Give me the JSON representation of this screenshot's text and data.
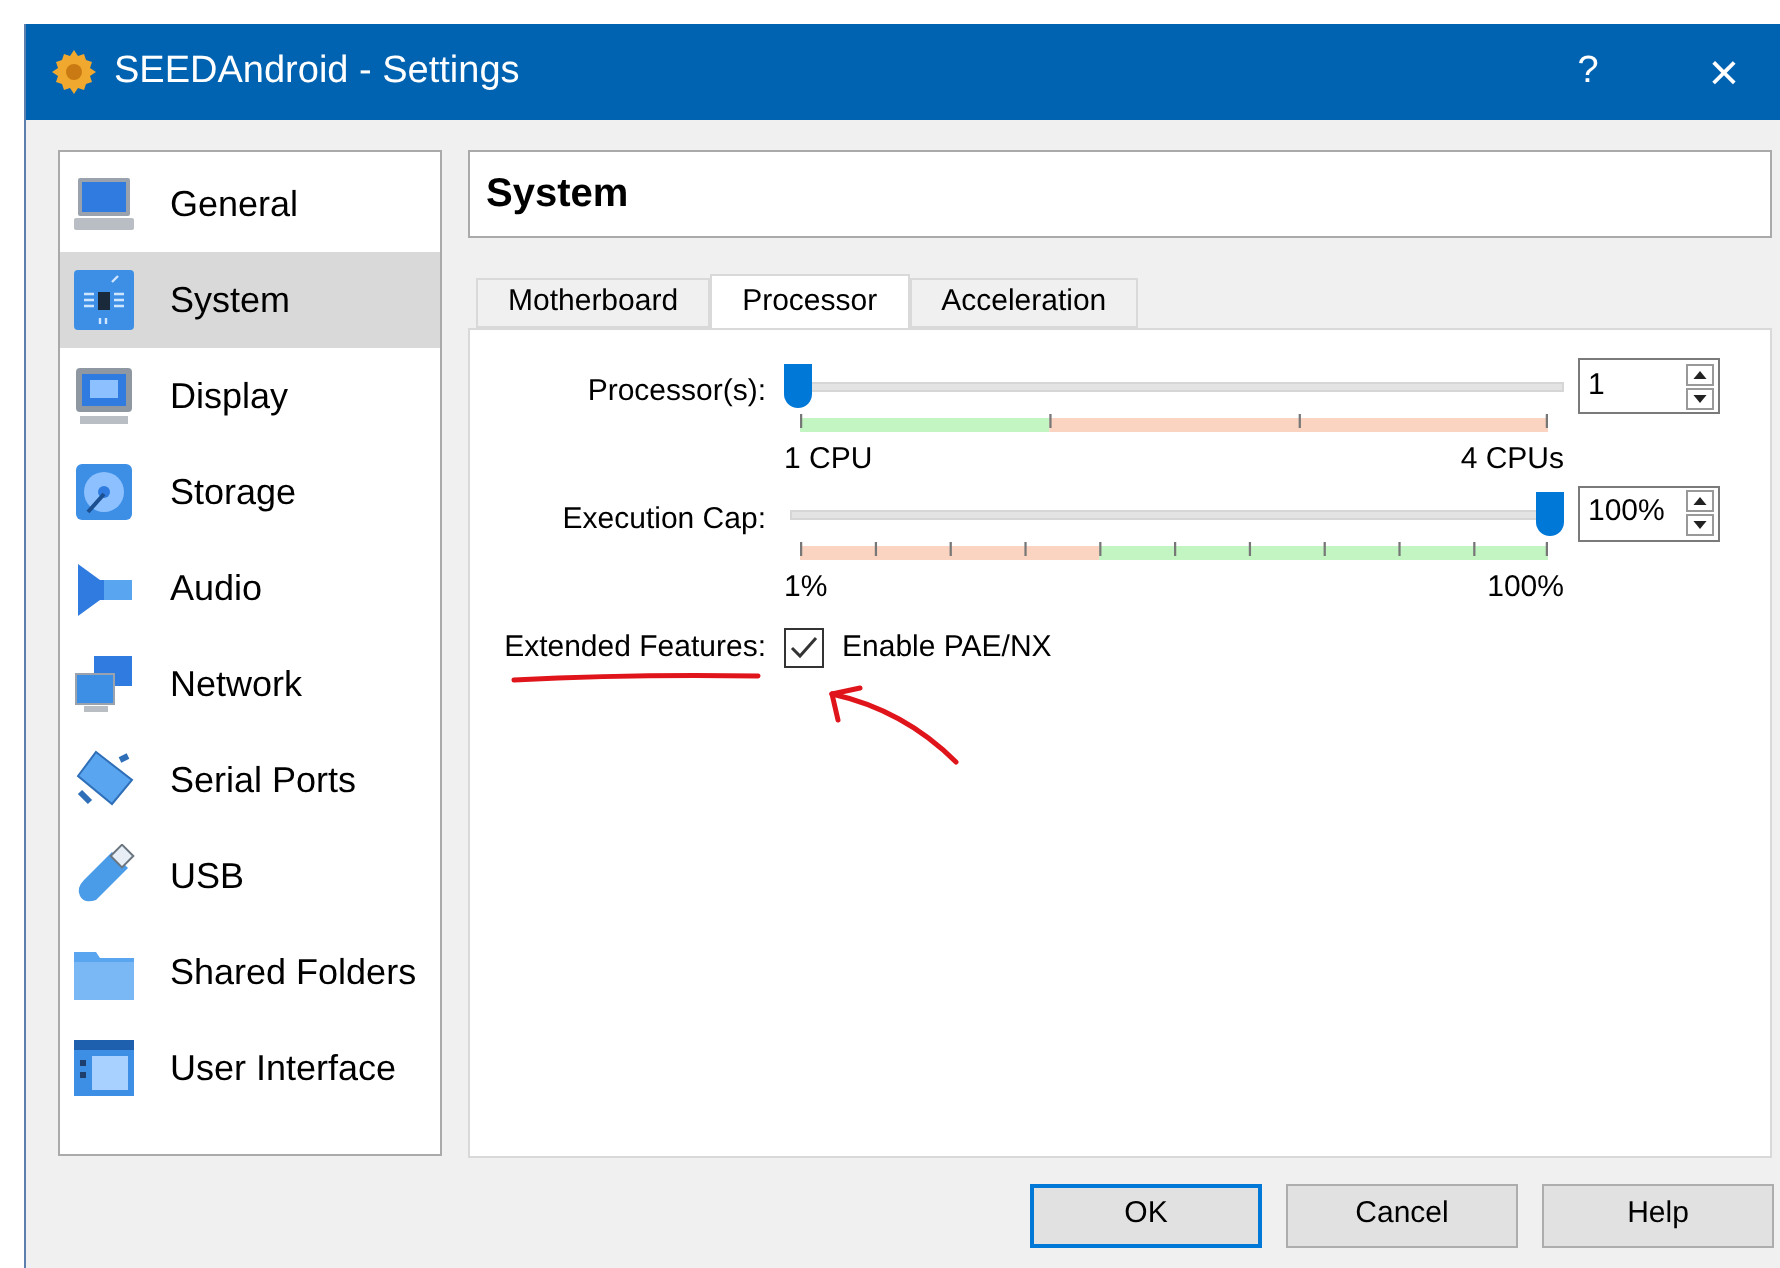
{
  "window": {
    "title": "SEEDAndroid - Settings",
    "help": "?",
    "close": "×"
  },
  "sidebar": {
    "items": [
      {
        "kind": "laptop",
        "label": "General",
        "selected": false
      },
      {
        "kind": "chip",
        "label": "System",
        "selected": true
      },
      {
        "kind": "display",
        "label": "Display",
        "selected": false
      },
      {
        "kind": "disc",
        "label": "Storage",
        "selected": false
      },
      {
        "kind": "speaker",
        "label": "Audio",
        "selected": false
      },
      {
        "kind": "network",
        "label": "Network",
        "selected": false
      },
      {
        "kind": "serial",
        "label": "Serial Ports",
        "selected": false
      },
      {
        "kind": "usb",
        "label": "USB",
        "selected": false
      },
      {
        "kind": "folder",
        "label": "Shared Folders",
        "selected": false
      },
      {
        "kind": "window",
        "label": "User Interface",
        "selected": false
      }
    ]
  },
  "page_title": "System",
  "tabs": [
    {
      "label": "Motherboard",
      "selected": false
    },
    {
      "label": "Processor",
      "selected": true
    },
    {
      "label": "Acceleration",
      "selected": false
    }
  ],
  "sliders": [
    {
      "kind": "cpu",
      "label": "Processor(s):",
      "level": 0,
      "min_label": "1 CPU",
      "max_label": "4 CPUs",
      "value": "1"
    },
    {
      "kind": "cap",
      "label": "Execution Cap:",
      "level": 1,
      "min_label": "1%",
      "max_label": "100%",
      "value": "100%"
    }
  ],
  "extended_features": {
    "label": "Extended Features:",
    "option": "Enable PAE/NX",
    "checked": true
  },
  "buttons": [
    {
      "label": "OK",
      "default": true
    },
    {
      "label": "Cancel",
      "default": false
    },
    {
      "label": "Help",
      "default": false
    }
  ]
}
